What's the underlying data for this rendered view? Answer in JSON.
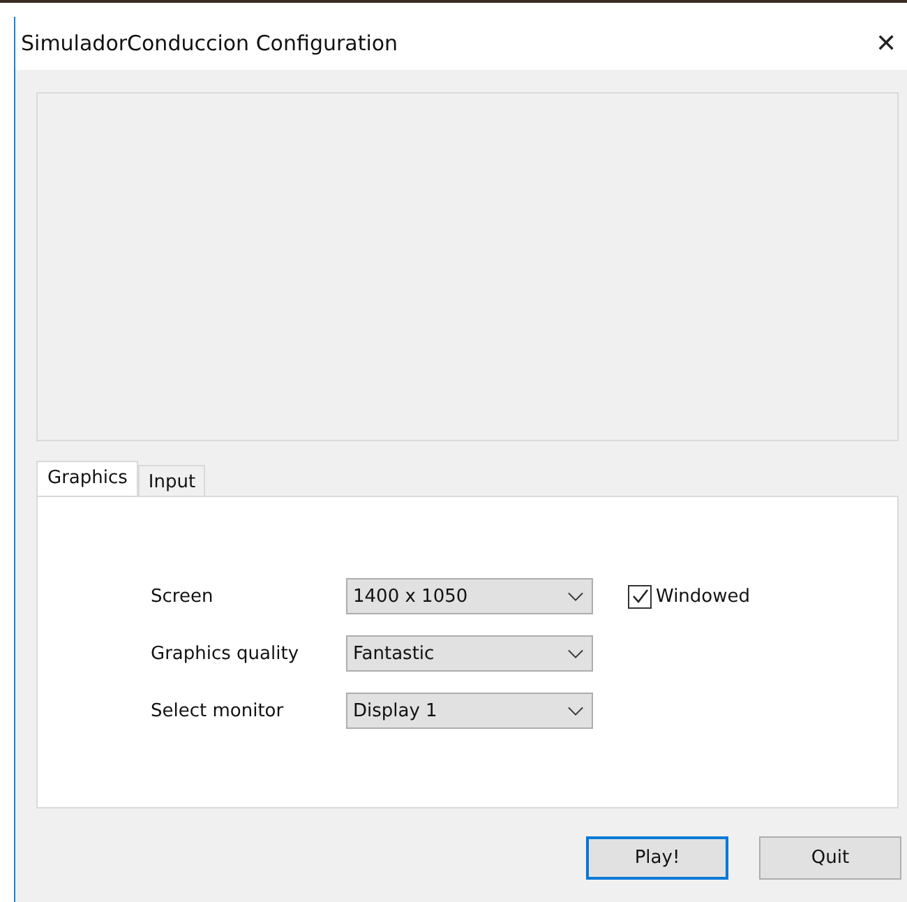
{
  "window": {
    "title": "SimuladorConduccion Configuration",
    "close": "✕"
  },
  "tabs": [
    {
      "label": "Graphics",
      "selected": true
    },
    {
      "label": "Input",
      "selected": false
    }
  ],
  "settings": [
    {
      "label": "Screen",
      "value": "1400 x 1050"
    },
    {
      "label": "Graphics quality",
      "value": "Fantastic"
    },
    {
      "label": "Select monitor",
      "value": "Display 1"
    }
  ],
  "windowed": {
    "label": "Windowed",
    "checked": true
  },
  "buttons": [
    {
      "label": "Play!",
      "focused": true
    },
    {
      "label": "Quit",
      "focused": false
    }
  ]
}
